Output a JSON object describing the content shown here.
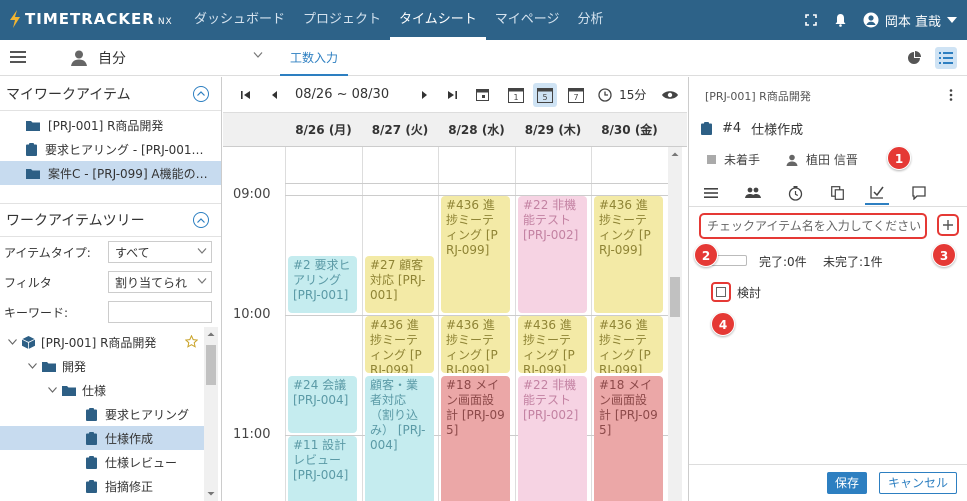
{
  "app": {
    "logo_text": "TIMETRACKER",
    "logo_suffix": "NX"
  },
  "nav": [
    "ダッシュボード",
    "プロジェクト",
    "タイムシート",
    "マイページ",
    "分析"
  ],
  "user": {
    "name": "岡本 直哉"
  },
  "secbar": {
    "self_label": "自分",
    "tab_label": "工数入力"
  },
  "left": {
    "my_items_title": "マイワークアイテム",
    "my_items": [
      "[PRJ-001] R商品開発",
      "要求ヒアリング - [PRJ-001…",
      "案件C - [PRJ-099] A機能の…"
    ],
    "tree_title": "ワークアイテムツリー",
    "filters": [
      {
        "label": "アイテムタイプ:",
        "value": "すべて"
      },
      {
        "label": "フィルタ",
        "value": "割り当てられ"
      },
      {
        "label": "キーワード:",
        "value": ""
      }
    ],
    "tree": [
      "[PRJ-001] R商品開発",
      "開発",
      "仕様",
      "要求ヒアリング",
      "仕様作成",
      "仕様レビュー",
      "指摘修正"
    ]
  },
  "calendar": {
    "range": "08/26 ~ 08/30",
    "interval": "15分",
    "days": [
      "8/26 (月)",
      "8/27 (火)",
      "8/28 (水)",
      "8/29 (木)",
      "8/30 (金)"
    ],
    "times": [
      "09:00",
      "10:00",
      "11:00"
    ],
    "events": [
      {
        "day": 0,
        "start": 9.5,
        "end": 10.0,
        "color": "teal",
        "text": "#2 要求ヒアリング [PRJ-001]"
      },
      {
        "day": 0,
        "start": 10.5,
        "end": 11.0,
        "color": "teal",
        "text": "#24 会議 [PRJ-004]"
      },
      {
        "day": 0,
        "start": 11.0,
        "end": 11.75,
        "color": "teal",
        "text": "#11 設計レビュー [PRJ-004]"
      },
      {
        "day": 1,
        "start": 9.5,
        "end": 10.0,
        "color": "yel",
        "text": "#27 顧客対応 [PRJ-001]"
      },
      {
        "day": 1,
        "start": 10.0,
        "end": 10.5,
        "color": "yel",
        "text": "#436 進捗ミーティング [PRJ-099]"
      },
      {
        "day": 1,
        "start": 10.5,
        "end": 11.75,
        "color": "teal",
        "text": "顧客・業者対応（割り込み） [PRJ-004]"
      },
      {
        "day": 2,
        "start": 9.0,
        "end": 10.0,
        "color": "yel",
        "text": "#436 進捗ミーティング [PRJ-099]"
      },
      {
        "day": 2,
        "start": 10.0,
        "end": 10.5,
        "color": "yel",
        "text": "#436 進捗ミーティング [PRJ-099]"
      },
      {
        "day": 2,
        "start": 10.5,
        "end": 11.75,
        "color": "red",
        "text": "#18 メイン画面設計 [PRJ-095]"
      },
      {
        "day": 3,
        "start": 9.0,
        "end": 10.0,
        "color": "pink",
        "text": "#22 非機能テスト [PRJ-002]"
      },
      {
        "day": 3,
        "start": 10.0,
        "end": 10.5,
        "color": "yel",
        "text": "#436 進捗ミーティング [PRJ-099]"
      },
      {
        "day": 3,
        "start": 10.5,
        "end": 11.75,
        "color": "pink",
        "text": "#22 非機能テスト [PRJ-002]"
      },
      {
        "day": 4,
        "start": 9.0,
        "end": 10.0,
        "color": "yel",
        "text": "#436 進捗ミーティング [PRJ-099]"
      },
      {
        "day": 4,
        "start": 10.0,
        "end": 10.5,
        "color": "yel",
        "text": "#436 進捗ミーティング [PRJ-099]"
      },
      {
        "day": 4,
        "start": 10.5,
        "end": 11.75,
        "color": "red",
        "text": "#18 メイン画面設計 [PRJ-095]"
      }
    ]
  },
  "detail": {
    "project": "[PRJ-001] R商品開発",
    "item_no": "#4",
    "item_title": "仕様作成",
    "status": "未着手",
    "assignee": "植田 信晋",
    "check_placeholder": "チェックアイテム名を入力してください",
    "done_count": "完了:0件",
    "undone_count": "未完了:1件",
    "check_item": "検討",
    "save": "保存",
    "cancel": "キャンセル",
    "badges": [
      "1",
      "2",
      "3",
      "4"
    ]
  }
}
